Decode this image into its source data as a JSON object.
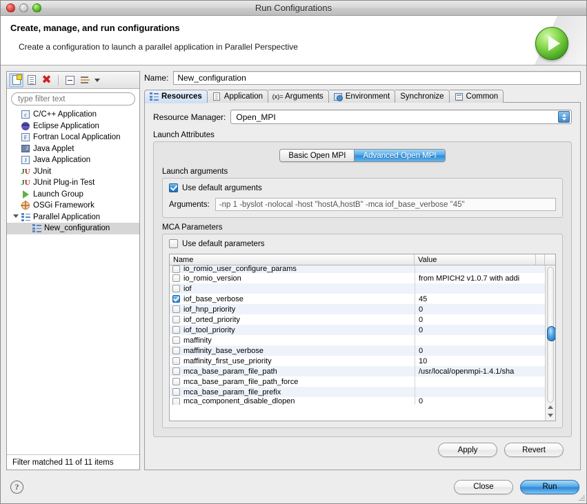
{
  "window": {
    "title": "Run Configurations",
    "traffic_lights": [
      "close-red",
      "minimize-gray",
      "zoom-green"
    ]
  },
  "banner": {
    "title": "Create, manage, and run configurations",
    "subtitle": "Create a configuration to launch a parallel application in Parallel Perspective",
    "icon": "run-play-icon"
  },
  "sidebar": {
    "toolbar": [
      {
        "name": "new-configuration-icon",
        "label": "New"
      },
      {
        "name": "duplicate-configuration-icon",
        "label": "Duplicate"
      },
      {
        "name": "delete-configuration-icon",
        "label": "Delete"
      },
      {
        "name": "collapse-all-icon",
        "label": "Collapse All"
      },
      {
        "name": "filter-launch-configurations-icon",
        "label": "Filter"
      }
    ],
    "filter_placeholder": "type filter text",
    "filter_value": "",
    "tree": [
      {
        "label": "C/C++ Application",
        "icon": "c-application-icon",
        "indent": 0,
        "selected": false
      },
      {
        "label": "Eclipse Application",
        "icon": "eclipse-application-icon",
        "indent": 0,
        "selected": false
      },
      {
        "label": "Fortran Local Application",
        "icon": "fortran-application-icon",
        "indent": 0,
        "selected": false
      },
      {
        "label": "Java Applet",
        "icon": "java-applet-icon",
        "indent": 0,
        "selected": false
      },
      {
        "label": "Java Application",
        "icon": "java-application-icon",
        "indent": 0,
        "selected": false
      },
      {
        "label": "JUnit",
        "icon": "junit-icon",
        "indent": 0,
        "selected": false
      },
      {
        "label": "JUnit Plug-in Test",
        "icon": "junit-plugin-test-icon",
        "indent": 0,
        "selected": false
      },
      {
        "label": "Launch Group",
        "icon": "launch-group-icon",
        "indent": 0,
        "selected": false
      },
      {
        "label": "OSGi Framework",
        "icon": "osgi-framework-icon",
        "indent": 0,
        "selected": false
      },
      {
        "label": "Parallel Application",
        "icon": "parallel-application-icon",
        "indent": 0,
        "selected": false,
        "expanded": true
      },
      {
        "label": "New_configuration",
        "icon": "parallel-application-icon",
        "indent": 1,
        "selected": true
      }
    ],
    "status": "Filter matched 11 of 11 items"
  },
  "main": {
    "name_label": "Name:",
    "name_value": "New_configuration",
    "tabs": [
      {
        "label": "Resources",
        "icon": "resources-icon",
        "active": true
      },
      {
        "label": "Application",
        "icon": "application-page-icon",
        "active": false
      },
      {
        "label": "Arguments",
        "icon": "arguments-xeq-icon",
        "active": false
      },
      {
        "label": "Environment",
        "icon": "environment-icon",
        "active": false
      },
      {
        "label": "Synchronize",
        "icon": "",
        "active": false
      },
      {
        "label": "Common",
        "icon": "common-icon",
        "active": false
      }
    ],
    "resource_manager_label": "Resource Manager:",
    "resource_manager_value": "Open_MPI",
    "launch_attributes_label": "Launch Attributes",
    "segmented": {
      "options": [
        "Basic Open MPI",
        "Advanced Open MPI"
      ],
      "selected": "Advanced Open MPI"
    },
    "launch_arguments": {
      "group_label": "Launch arguments",
      "use_default_label": "Use default arguments",
      "use_default_checked": true,
      "arguments_label": "Arguments:",
      "arguments_value": "-np 1 -byslot -nolocal -host \"hostA,hostB\" -mca iof_base_verbose \"45\""
    },
    "mca": {
      "group_label": "MCA Parameters",
      "use_default_label": "Use default parameters",
      "use_default_checked": false,
      "columns": [
        "Name",
        "Value"
      ],
      "rows": [
        {
          "checked": false,
          "name": "io_romio_user_configure_params",
          "value": "",
          "clip": "top"
        },
        {
          "checked": false,
          "name": "io_romio_version",
          "value": "from MPICH2 v1.0.7 with addi"
        },
        {
          "checked": false,
          "name": "iof",
          "value": ""
        },
        {
          "checked": true,
          "name": "iof_base_verbose",
          "value": "45"
        },
        {
          "checked": false,
          "name": "iof_hnp_priority",
          "value": "0"
        },
        {
          "checked": false,
          "name": "iof_orted_priority",
          "value": "0"
        },
        {
          "checked": false,
          "name": "iof_tool_priority",
          "value": "0"
        },
        {
          "checked": false,
          "name": "maffinity",
          "value": ""
        },
        {
          "checked": false,
          "name": "maffinity_base_verbose",
          "value": "0"
        },
        {
          "checked": false,
          "name": "maffinity_first_use_priority",
          "value": "10"
        },
        {
          "checked": false,
          "name": "mca_base_param_file_path",
          "value": "/usr/local/openmpi-1.4.1/sha"
        },
        {
          "checked": false,
          "name": "mca_base_param_file_path_force",
          "value": ""
        },
        {
          "checked": false,
          "name": "mca_base_param_file_prefix",
          "value": ""
        },
        {
          "checked": false,
          "name": "mca_component_disable_dlopen",
          "value": "0",
          "clip": "bottom"
        }
      ]
    },
    "apply_label": "Apply",
    "revert_label": "Revert"
  },
  "footer": {
    "help_icon": "help-icon",
    "close_label": "Close",
    "run_label": "Run"
  },
  "colors": {
    "accent_blue": "#2d8ad8",
    "selection_gray": "#d6d6d6",
    "alt_row": "#eef3fb",
    "delete_red": "#d02020",
    "run_green": "#3f9e1b"
  }
}
